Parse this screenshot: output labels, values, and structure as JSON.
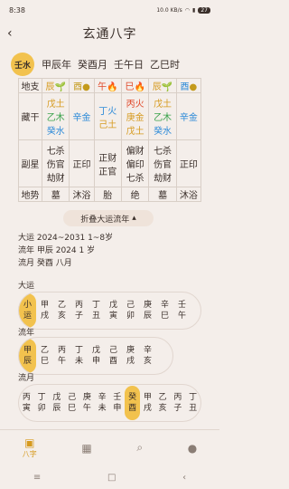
{
  "status": {
    "time": "8:38",
    "speed": "10.0 KB/s",
    "battery": "27"
  },
  "title": "玄通八字",
  "pillars_header": {
    "badge": "壬水",
    "items": [
      "甲辰年",
      "癸酉月",
      "壬午日",
      "乙巳时"
    ]
  },
  "grid": {
    "row_labels": [
      "地支",
      "藏干",
      "副星",
      "地势"
    ],
    "dizhi": [
      "辰",
      "酉",
      "午",
      "巳",
      "辰",
      "酉"
    ],
    "canggan": [
      [
        "戊土",
        "乙木",
        "癸水"
      ],
      [
        "辛金"
      ],
      [
        "丁火",
        "己土"
      ],
      [
        "丙火",
        "庚金",
        "戊土"
      ],
      [
        "戊土",
        "乙木",
        "癸水"
      ],
      [
        "辛金"
      ]
    ],
    "fuxing": [
      [
        "七杀",
        "伤官",
        "劫财"
      ],
      [
        "正印"
      ],
      [
        "正财",
        "正官"
      ],
      [
        "偏财",
        "偏印",
        "七杀"
      ],
      [
        "七杀",
        "伤官",
        "劫财"
      ],
      [
        "正印"
      ]
    ],
    "dishi": [
      "墓",
      "沐浴",
      "胎",
      "绝",
      "墓",
      "沐浴"
    ]
  },
  "toggle_label": "折叠大运流年",
  "info": {
    "dayun": "大运  2024~2031 1~8岁",
    "liunian": "流年 甲辰 2024 1 岁",
    "liuyue": "流月 癸酉 八月"
  },
  "dayun": {
    "label": "大运",
    "cells": [
      [
        "小",
        "运"
      ],
      [
        "甲",
        "戌"
      ],
      [
        "乙",
        "亥"
      ],
      [
        "丙",
        "子"
      ],
      [
        "丁",
        "丑"
      ],
      [
        "戊",
        "寅"
      ],
      [
        "己",
        "卯"
      ],
      [
        "庚",
        "辰"
      ],
      [
        "辛",
        "巳"
      ],
      [
        "壬",
        "午"
      ]
    ]
  },
  "liunian": {
    "label": "流年",
    "cells": [
      [
        "甲",
        "辰"
      ],
      [
        "乙",
        "巳"
      ],
      [
        "丙",
        "午"
      ],
      [
        "丁",
        "未"
      ],
      [
        "戊",
        "申"
      ],
      [
        "己",
        "酉"
      ],
      [
        "庚",
        "戌"
      ],
      [
        "辛",
        "亥"
      ]
    ]
  },
  "liuyue": {
    "label": "流月",
    "cells": [
      [
        "丙",
        "寅"
      ],
      [
        "丁",
        "卯"
      ],
      [
        "戊",
        "辰"
      ],
      [
        "己",
        "巳"
      ],
      [
        "庚",
        "午"
      ],
      [
        "辛",
        "未"
      ],
      [
        "壬",
        "申"
      ],
      [
        "癸",
        "酉"
      ],
      [
        "甲",
        "戌"
      ],
      [
        "乙",
        "亥"
      ],
      [
        "丙",
        "子"
      ],
      [
        "丁",
        "丑"
      ]
    ]
  },
  "tabs": [
    "八字",
    "",
    "",
    ""
  ],
  "colors": {
    "accent": "#f2c24e",
    "fire": "#e0492a",
    "earth": "#d69a1e",
    "water": "#2c8ad8",
    "wood": "#3aa24b"
  }
}
